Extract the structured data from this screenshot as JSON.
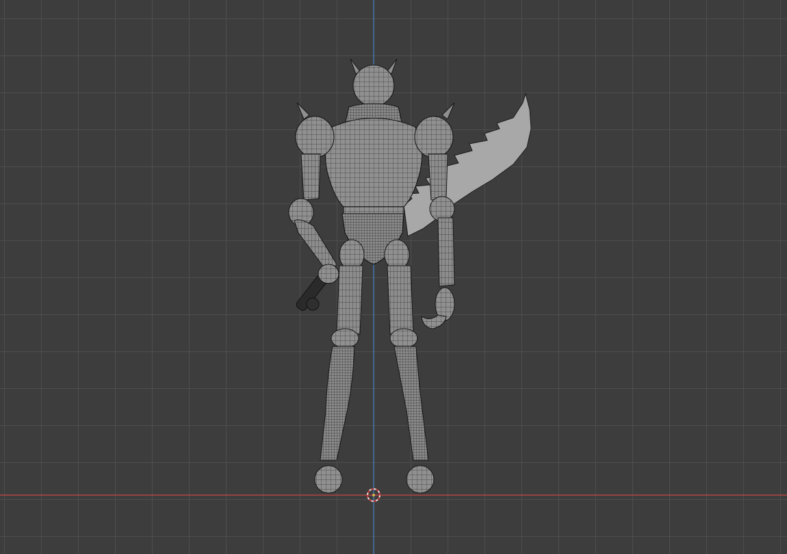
{
  "viewport": {
    "mode": "3d-viewport-front-orthographic",
    "background_color": "#3d3d3d",
    "grid_color": "#505050",
    "x_axis_color": "#c94545",
    "z_axis_color": "#3f7fbf",
    "mesh_color": "#8f8f8f",
    "wire_color": "#1f1f1f"
  },
  "scene": {
    "object": "armored-character-wireframe",
    "cursor_icon": "3d-cursor-icon"
  }
}
